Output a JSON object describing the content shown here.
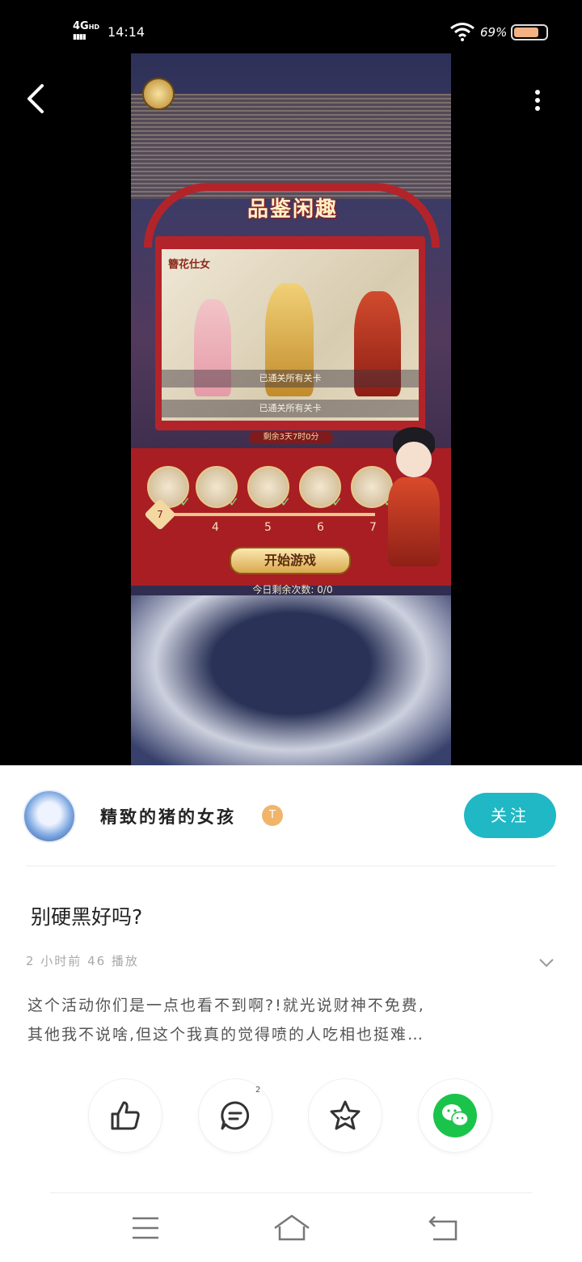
{
  "status_bar": {
    "network": "4G",
    "network_hd": "HD",
    "time": "14:14",
    "battery": "69%"
  },
  "game": {
    "banner_title": "品鉴闲趣",
    "painting_label": "簪花仕女",
    "passed_1": "已通关所有关卡",
    "passed_2": "已通关所有关卡",
    "remaining_time": "剩余3天7时0分",
    "current_step": "7",
    "steps": [
      "4",
      "5",
      "6",
      "7"
    ],
    "start_button": "开始游戏",
    "today_remaining": "今日剩余次数: 0/0"
  },
  "author": {
    "username": "精致的猪的女孩",
    "level_badge": "T",
    "follow_label": "关注"
  },
  "post": {
    "title": "别硬黑好吗?",
    "meta": "2 小时前  46 播放",
    "body_line1": "这个活动你们是一点也看不到啊?!就光说财神不免费,",
    "body_line2": "其他我不说啥,但这个我真的觉得喷的人吃相也挺难…"
  },
  "actions": {
    "comment_count": "2",
    "icons": [
      "thumbs-up-icon",
      "comment-icon",
      "star-icon",
      "wechat-icon"
    ]
  },
  "colors": {
    "accent": "#1fb8c4",
    "wechat": "#1ac44a",
    "game_red": "#b3242a"
  }
}
